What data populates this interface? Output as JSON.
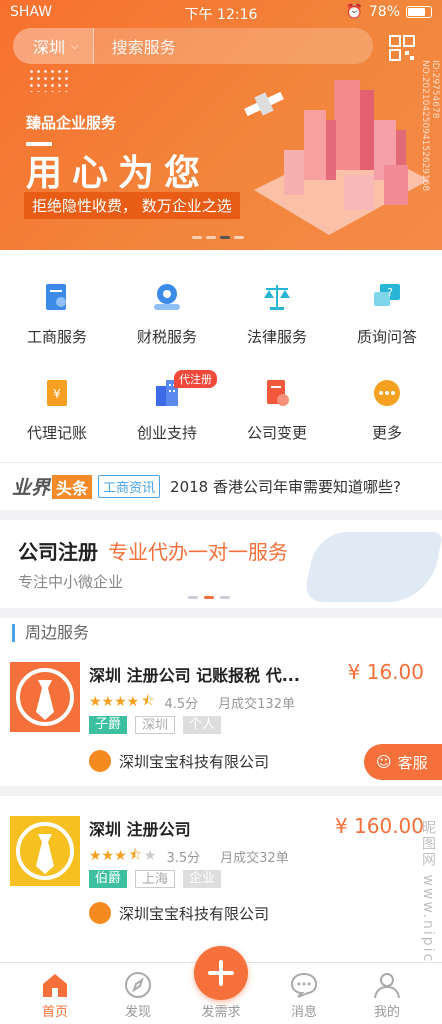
{
  "status": {
    "carrier": "SHAW",
    "time": "下午 12:16",
    "battery": "78%"
  },
  "search": {
    "city": "深圳",
    "placeholder": "搜索服务"
  },
  "banner": {
    "subtitle": "臻品企业服务",
    "headline": "用心为您",
    "slogan": "拒绝隐性收费，  数万企业之选",
    "watermark": "ID:29754678 NO:20210425094152629168"
  },
  "services": [
    {
      "label": "工商服务",
      "icon": "business-license-icon",
      "color": "#3d8be8"
    },
    {
      "label": "财税服务",
      "icon": "finance-tax-icon",
      "color": "#3d8be8"
    },
    {
      "label": "法律服务",
      "icon": "scales-icon",
      "color": "#29b6d6"
    },
    {
      "label": "质询问答",
      "icon": "question-chat-icon",
      "color": "#29b6d6"
    },
    {
      "label": "代理记账",
      "icon": "accounting-icon",
      "color": "#f5a020"
    },
    {
      "label": "创业支持",
      "icon": "building-icon",
      "color": "#3d6be8",
      "badge": "代注册"
    },
    {
      "label": "公司变更",
      "icon": "document-change-icon",
      "color": "#f2583a"
    },
    {
      "label": "更多",
      "icon": "more-icon",
      "color": "#f5a020"
    }
  ],
  "ticker": {
    "logo_a": "业界",
    "logo_b": "头条",
    "tag": "工商资讯",
    "text": "2018 香港公司年审需要知道哪些?"
  },
  "promo": {
    "title": "公司注册",
    "highlight": "专业代办一对一服务",
    "desc": "专注中小微企业"
  },
  "nearby": {
    "header": "周边服务",
    "items": [
      {
        "name": "深圳 注册公司 记账报税 代...",
        "price": "¥ 16.00",
        "rating": 4.5,
        "score": "4.5分",
        "sold": "月成交132单",
        "tags": [
          "子爵",
          "深圳",
          "个人"
        ],
        "company": "深圳宝宝科技有限公司",
        "thumb_color": "#f5703a"
      },
      {
        "name": "深圳 注册公司",
        "price": "¥ 160.00",
        "rating": 3.5,
        "score": "3.5分",
        "sold": "月成交32单",
        "tags": [
          "伯爵",
          "上海",
          "企业"
        ],
        "company": "深圳宝宝科技有限公司",
        "thumb_color": "#f5c020"
      }
    ]
  },
  "kefu": {
    "label": "客服"
  },
  "tabs": [
    {
      "label": "首页",
      "icon": "home-icon",
      "active": true
    },
    {
      "label": "发现",
      "icon": "compass-icon",
      "active": false
    },
    {
      "label": "发需求",
      "icon": "plus-icon",
      "active": false
    },
    {
      "label": "消息",
      "icon": "message-icon",
      "active": false
    },
    {
      "label": "我的",
      "icon": "user-icon",
      "active": false
    }
  ],
  "site_watermark": "昵图网 www.nipic.com"
}
